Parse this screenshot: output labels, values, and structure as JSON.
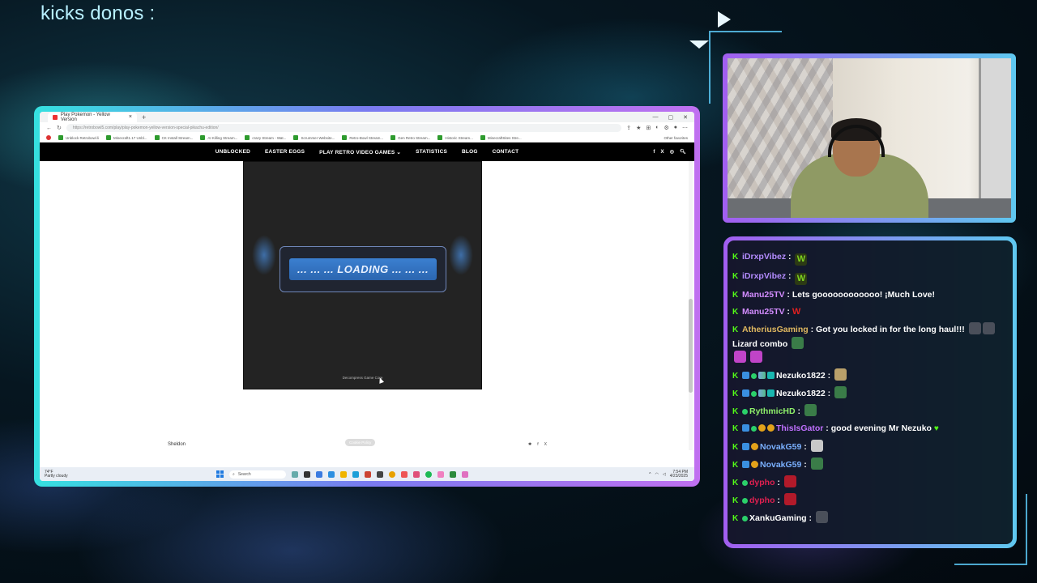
{
  "overlay": {
    "header_text": "kicks donos :"
  },
  "browser": {
    "tab_title": "Play Pokemon - Yellow Version",
    "url": "https://retrobowl5.com/play/play-pokemon-yellow-version-special-pikachu-edition/",
    "bookmarks": [
      "Unblock Retrobowl.li",
      "Minecraft1.17 Unbl...",
      "CK Install Stream...",
      "AI Killing Stream...",
      "crazy Stream - Wat...",
      "Scrummer Website...",
      "Retro-Bowl Stream...",
      "Gen Retro Stream...",
      "Historic Stream...",
      "MinecraftSites Stre..."
    ],
    "other_bookmarks": "Other favorites",
    "nav_items": [
      "UNBLOCKED",
      "EASTER EGGS",
      "PLAY RETRO VIDEO GAMES ⌄",
      "STATISTICS",
      "BLOG",
      "CONTACT"
    ],
    "social_icons": [
      "f",
      "X",
      "◎"
    ],
    "loading_text": "... ... ... LOADING ... ... ...",
    "decompress_text": "Decompress Game Core",
    "footer_name": "Sheldon",
    "cookie_text": "Cookie Policy",
    "footer_social": [
      "✱",
      "f",
      "X"
    ]
  },
  "taskbar": {
    "weather_temp": "74°F",
    "weather_desc": "Partly cloudy",
    "search_placeholder": "Search",
    "time": "7:54 PM",
    "date": "4/23/2025"
  },
  "chat": {
    "messages": [
      {
        "user": "iDrxpVibez",
        "color": "#b48cff",
        "text": "",
        "emotes": [
          "W"
        ]
      },
      {
        "user": "iDrxpVibez",
        "color": "#b48cff",
        "text": "",
        "emotes": [
          "W"
        ]
      },
      {
        "user": "Manu25TV",
        "color": "#d38cff",
        "text": "Lets goooooooooooo! ¡Much Love!",
        "emotes": []
      },
      {
        "user": "Manu25TV",
        "color": "#d38cff",
        "text": "",
        "emotes": [
          "W-red"
        ]
      },
      {
        "user": "AtheriusGaming",
        "color": "#e0b860",
        "text": "Got you locked in for the long haul!!!",
        "text2": "Lizard combo",
        "emotes": []
      },
      {
        "user": "Nezuko1822",
        "color": "#ffffff",
        "text": "",
        "emotes": [
          "face"
        ]
      },
      {
        "user": "Nezuko1822",
        "color": "#ffffff",
        "text": "",
        "emotes": [
          "green"
        ]
      },
      {
        "user": "RythmicHD",
        "color": "#8ff06a",
        "text": "",
        "emotes": [
          "green"
        ]
      },
      {
        "user": "ThisIsGator",
        "color": "#c070ff",
        "text": "good evening Mr Nezuko",
        "emotes": []
      },
      {
        "user": "NovakG59",
        "color": "#7ab0ff",
        "text": "",
        "emotes": [
          "white"
        ]
      },
      {
        "user": "NovakG59",
        "color": "#7ab0ff",
        "text": "",
        "emotes": [
          "green"
        ]
      },
      {
        "user": "dypho",
        "color": "#e02050",
        "text": "",
        "emotes": [
          "red"
        ]
      },
      {
        "user": "dypho",
        "color": "#e02050",
        "text": "",
        "emotes": [
          "red"
        ]
      },
      {
        "user": "XankuGaming",
        "color": "#ffffff",
        "text": "",
        "emotes": [
          "dark"
        ]
      }
    ]
  }
}
